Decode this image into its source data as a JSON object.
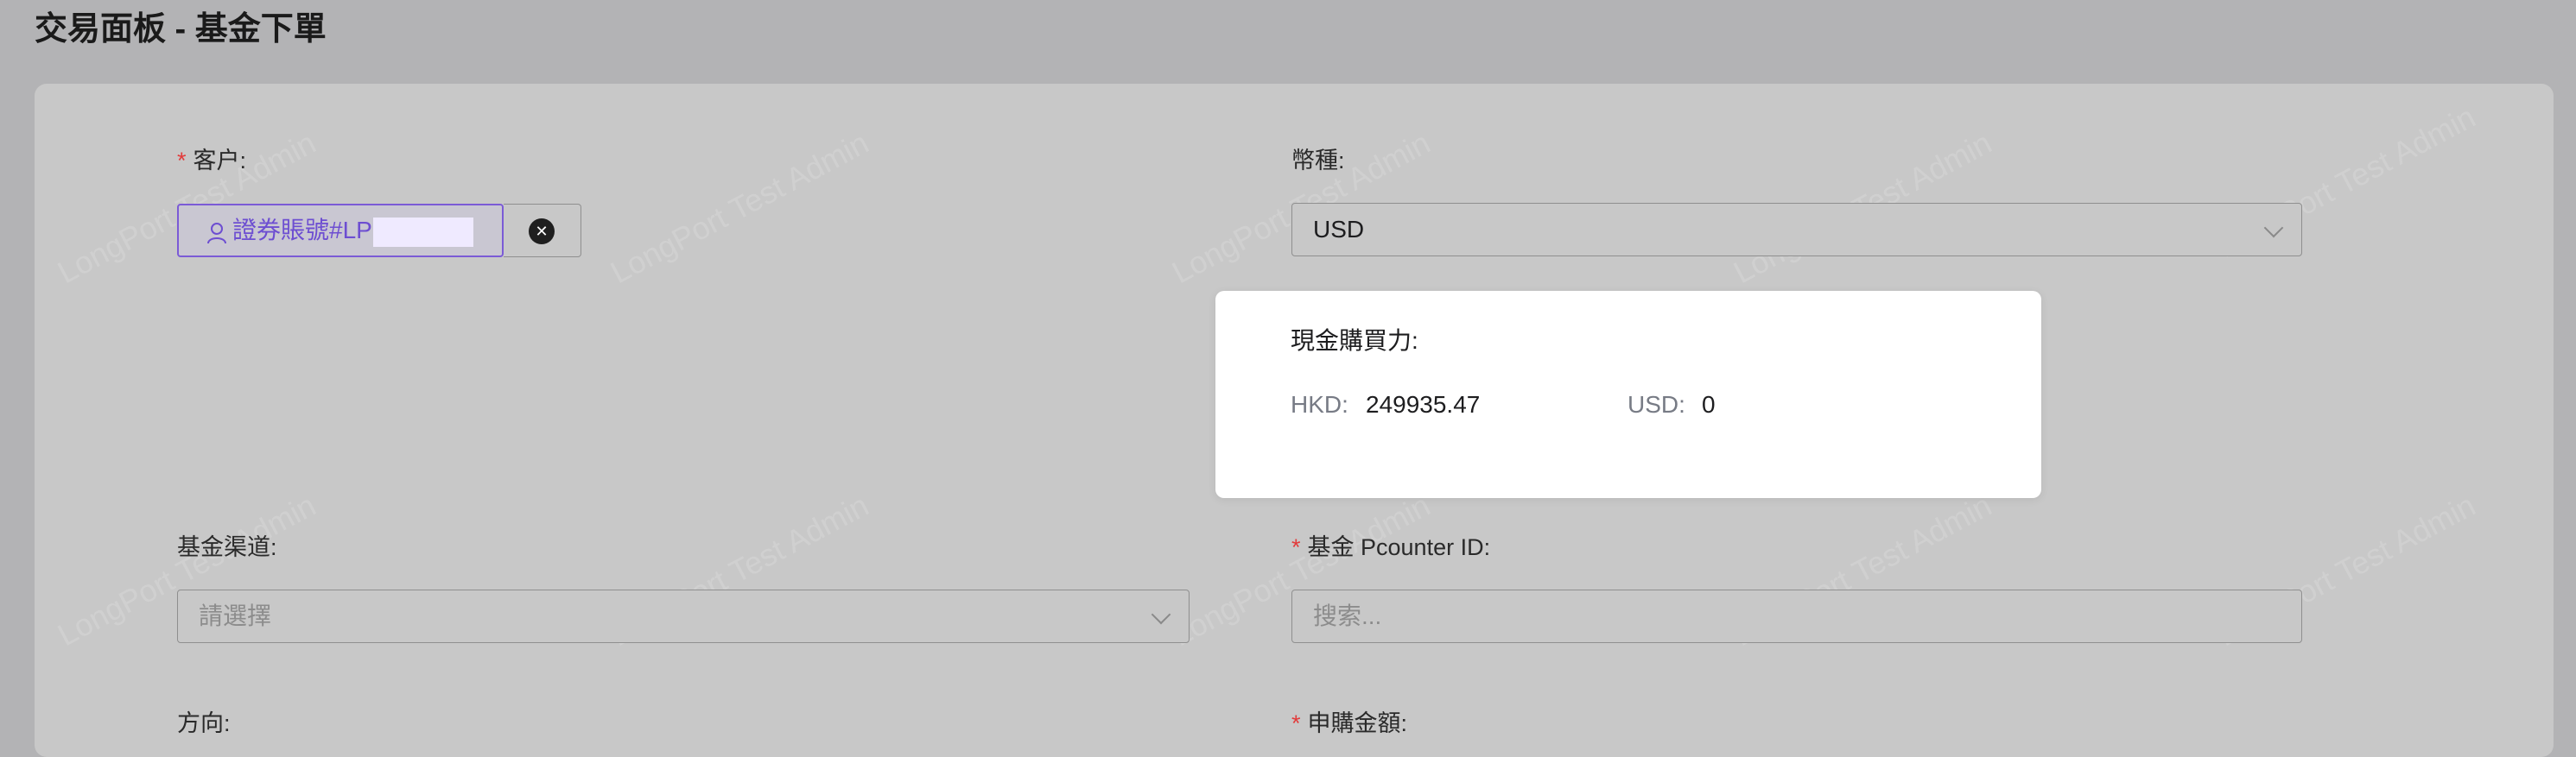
{
  "page": {
    "title": "交易面板 - 基金下單"
  },
  "watermark": "LongPort Test Admin",
  "form": {
    "client": {
      "label": "客户:",
      "required_mark": "*",
      "value": "證券賬號#LP",
      "clear_icon": "close-circle-icon",
      "user_icon": "user-icon"
    },
    "currency": {
      "label": "幣種:",
      "value": "USD"
    },
    "buying_power": {
      "title": "現金購買力:",
      "hkd_label": "HKD:",
      "hkd_value": "249935.47",
      "usd_label": "USD:",
      "usd_value": "0"
    },
    "fund_channel": {
      "label": "基金渠道:",
      "placeholder": "請選擇"
    },
    "pcounter": {
      "label": "基金 Pcounter ID:",
      "required_mark": "*",
      "placeholder": "搜索..."
    },
    "direction": {
      "label": "方向:"
    },
    "subscribe_amount": {
      "label": "申購金額:",
      "required_mark": "*"
    }
  },
  "colors": {
    "accent": "#6d4ed1",
    "required": "#e23b3b",
    "background": "#b3b3b5",
    "card": "#c8c8c8"
  }
}
